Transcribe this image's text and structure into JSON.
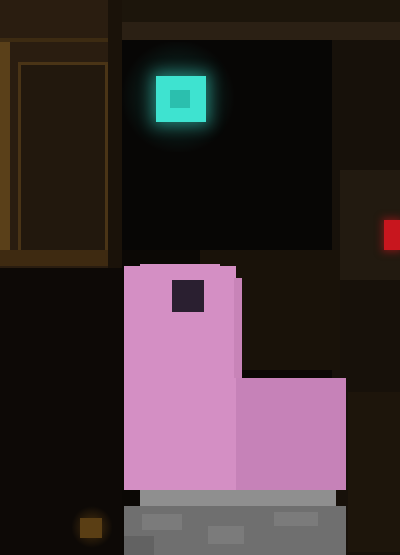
{
  "scene": {
    "type": "pixel-art-game-frame",
    "colors": {
      "background": "#0b0805",
      "wood": "#2a1d10",
      "wood_trim": "#5a4019",
      "gem": "#3ee3d0",
      "gem_glow": "#32dcc8",
      "red_light": "#c8161e",
      "character": "#d48fc4",
      "character_shade": "#c682b8",
      "character_eye": "#2a1f30",
      "stone": "#6f6f6f",
      "stone_light": "#8f8f8f"
    },
    "entities": [
      {
        "name": "player-character",
        "icon": "pink-blob-icon"
      },
      {
        "name": "gem-pickup",
        "icon": "cyan-gem-icon"
      },
      {
        "name": "red-indicator-light",
        "icon": "red-light-icon"
      },
      {
        "name": "stone-pedestal",
        "icon": "stone-block-icon"
      }
    ]
  }
}
